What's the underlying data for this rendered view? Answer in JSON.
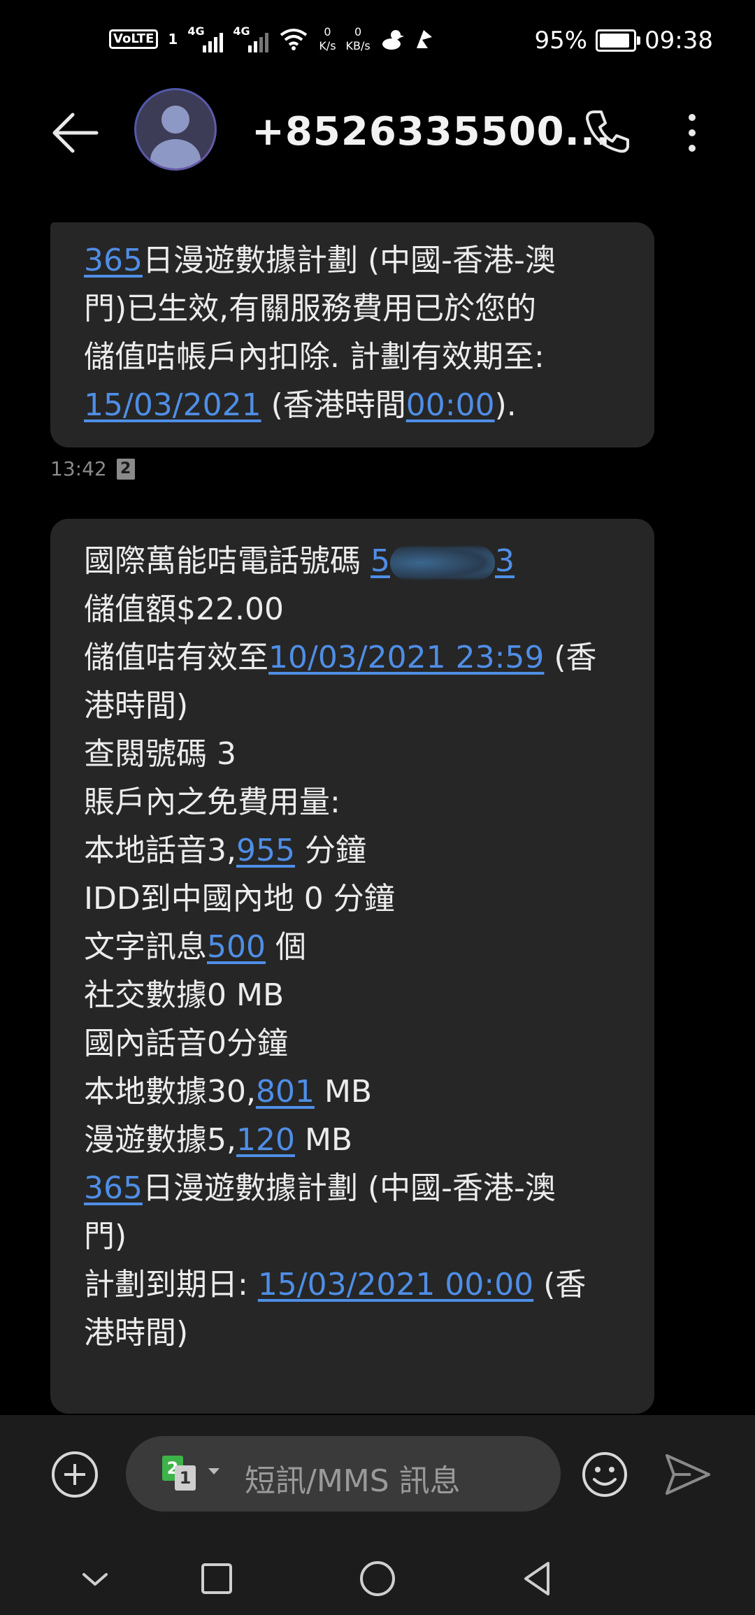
{
  "status_bar": {
    "volte": "VoLTE",
    "sim1_number": "1",
    "signal1_label": "4G",
    "signal2_label": "4G",
    "net_speed_value": "0",
    "net_speed_unit": "K/s",
    "net_speed2_value": "0",
    "net_speed2_unit": "KB/s",
    "battery_percent": "95%",
    "time": "09:38"
  },
  "header": {
    "title": "+8526335500..."
  },
  "messages": [
    {
      "segments": [
        {
          "text": "365",
          "link": true
        },
        {
          "text": "日漫遊數據計劃 (中國-香港-澳",
          "link": false
        },
        {
          "br": true
        },
        {
          "text": "門)已生效,有關服務費用已於您的",
          "link": false
        },
        {
          "br": true
        },
        {
          "text": "儲值咭帳戶內扣除. 計劃有效期至:",
          "link": false
        },
        {
          "br": true
        },
        {
          "text": "15/03/2021",
          "link": true
        },
        {
          "text": " (香港時間",
          "link": false
        },
        {
          "text": "00:00",
          "link": true
        },
        {
          "text": ").",
          "link": false
        }
      ],
      "time": "13:42",
      "sim_badge": "2"
    },
    {
      "lines": [
        {
          "parts": [
            {
              "t": "國際萬能咭電話號碼  ",
              "l": false
            },
            {
              "t": "5",
              "l": true
            },
            {
              "blur": true
            },
            {
              "t": "3",
              "l": true
            }
          ]
        },
        {
          "parts": [
            {
              "t": "儲值額$22.00",
              "l": false
            }
          ]
        },
        {
          "parts": [
            {
              "t": "儲值咭有效至",
              "l": false
            },
            {
              "t": "10/03/2021 23:59",
              "l": true
            },
            {
              "t": " (香",
              "l": false
            }
          ]
        },
        {
          "parts": [
            {
              "t": "港時間)",
              "l": false
            }
          ]
        },
        {
          "parts": [
            {
              "t": "查閱號碼 3",
              "l": false
            }
          ]
        },
        {
          "parts": [
            {
              "t": "賬戶內之免費用量:",
              "l": false
            }
          ]
        },
        {
          "parts": [
            {
              "t": "本地話音3,",
              "l": false
            },
            {
              "t": "955",
              "l": true
            },
            {
              "t": " 分鐘",
              "l": false
            }
          ]
        },
        {
          "parts": [
            {
              "t": "IDD到中國內地 0 分鐘",
              "l": false
            }
          ]
        },
        {
          "parts": [
            {
              "t": "文字訊息",
              "l": false
            },
            {
              "t": "500",
              "l": true
            },
            {
              "t": " 個",
              "l": false
            }
          ]
        },
        {
          "parts": [
            {
              "t": "社交數據0 MB",
              "l": false
            }
          ]
        },
        {
          "parts": [
            {
              "t": "國內話音0分鐘",
              "l": false
            }
          ]
        },
        {
          "parts": [
            {
              "t": "本地數據30,",
              "l": false
            },
            {
              "t": "801",
              "l": true
            },
            {
              "t": " MB",
              "l": false
            }
          ]
        },
        {
          "parts": [
            {
              "t": "漫遊數據5,",
              "l": false
            },
            {
              "t": "120",
              "l": true
            },
            {
              "t": " MB",
              "l": false
            }
          ]
        },
        {
          "parts": [
            {
              "t": "365",
              "l": true
            },
            {
              "t": "日漫遊數據計劃 (中國-香港-澳",
              "l": false
            }
          ]
        },
        {
          "parts": [
            {
              "t": "門)",
              "l": false
            }
          ]
        },
        {
          "parts": [
            {
              "t": "計劃到期日: ",
              "l": false
            },
            {
              "t": "15/03/2021 00:00",
              "l": true
            },
            {
              "t": " (香",
              "l": false
            }
          ]
        },
        {
          "parts": [
            {
              "t": "港時間)",
              "l": false
            }
          ]
        }
      ]
    }
  ],
  "compose": {
    "sim_primary": "2",
    "sim_secondary": "1",
    "placeholder": "短訊/MMS 訊息"
  },
  "colors": {
    "link": "#4f8ee6",
    "bubble": "#262626",
    "background": "#000000",
    "sim_green": "#3db34a"
  },
  "icons": [
    "back-arrow-icon",
    "avatar-icon",
    "phone-icon",
    "more-vertical-icon",
    "add-icon",
    "emoji-icon",
    "send-icon",
    "nav-down-icon",
    "nav-square-icon",
    "nav-circle-icon",
    "nav-back-icon"
  ]
}
